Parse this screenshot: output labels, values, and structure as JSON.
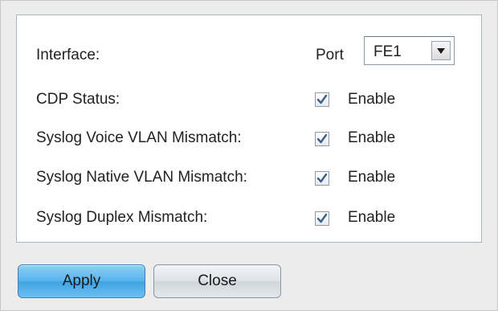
{
  "form": {
    "interface_label": "Interface:",
    "port_label": "Port",
    "port_select": {
      "value": "FE1"
    },
    "rows": [
      {
        "label": "CDP Status:",
        "checked": true,
        "option": "Enable"
      },
      {
        "label": "Syslog Voice VLAN Mismatch:",
        "checked": true,
        "option": "Enable"
      },
      {
        "label": "Syslog Native VLAN Mismatch:",
        "checked": true,
        "option": "Enable"
      },
      {
        "label": "Syslog Duplex Mismatch:",
        "checked": true,
        "option": "Enable"
      }
    ]
  },
  "buttons": {
    "apply": "Apply",
    "close": "Close"
  },
  "colors": {
    "apply_button": "#55b3ec",
    "checkmark": "#3b5f8a"
  }
}
